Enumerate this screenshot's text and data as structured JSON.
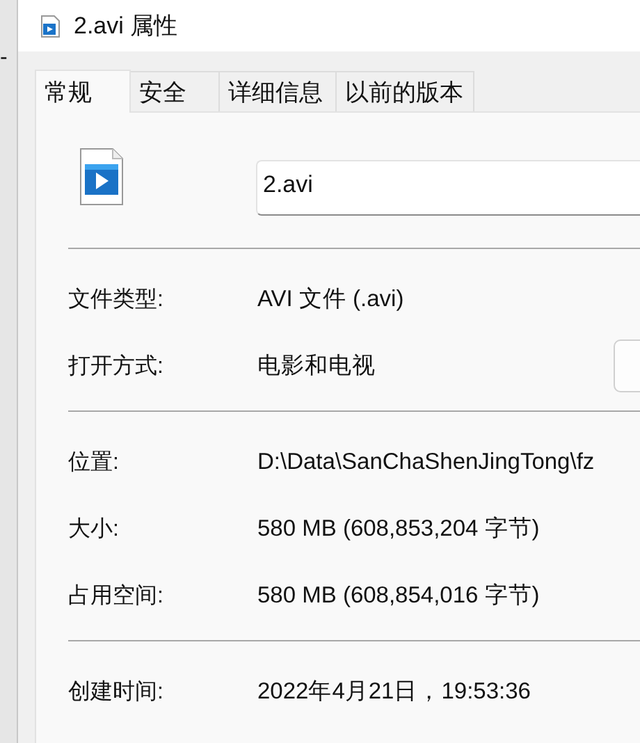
{
  "background_window": {
    "text": "-"
  },
  "window": {
    "title": "2.avi 属性"
  },
  "tabs": [
    {
      "label": "常规",
      "selected": true
    },
    {
      "label": "安全",
      "selected": false
    },
    {
      "label": "详细信息",
      "selected": false
    },
    {
      "label": "以前的版本",
      "selected": false
    }
  ],
  "file_name": {
    "value": "2.avi"
  },
  "sections": [
    {
      "rows": [
        {
          "label": "文件类型:",
          "value": "AVI 文件 (.avi)"
        },
        {
          "label": "打开方式:",
          "value": "电影和电视",
          "kind": "with-button"
        }
      ]
    },
    {
      "rows": [
        {
          "label": "位置:",
          "value": "D:\\Data\\SanChaShenJingTong\\fz"
        },
        {
          "label": "大小:",
          "value": "580 MB (608,853,204 字节)"
        },
        {
          "label": "占用空间:",
          "value": "580 MB (608,854,016 字节)"
        }
      ]
    },
    {
      "rows": [
        {
          "label": "创建时间:",
          "value": "2022年4月21日，19:53:36"
        }
      ]
    }
  ]
}
